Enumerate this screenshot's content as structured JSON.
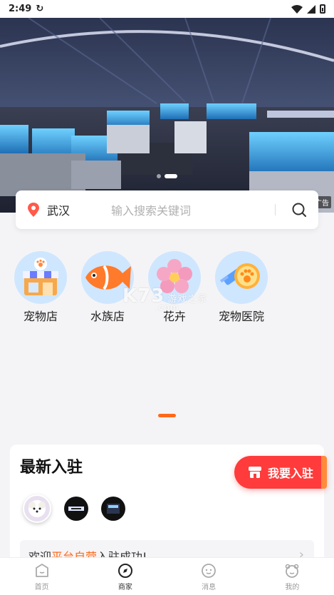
{
  "status_bar": {
    "time": "2:49"
  },
  "banner": {
    "tag": "广告",
    "slide_count": 2,
    "active_slide": 2
  },
  "search": {
    "city": "武汉",
    "placeholder": "输入搜索关键词"
  },
  "categories": [
    {
      "label": "宠物店",
      "icon": "pet-shop-icon"
    },
    {
      "label": "水族店",
      "icon": "fish-icon"
    },
    {
      "label": "花卉",
      "icon": "flower-icon"
    },
    {
      "label": "宠物医院",
      "icon": "pet-hospital-icon"
    }
  ],
  "watermark": {
    "text": "K73",
    "sub": "游戏之家",
    "domain": ".com"
  },
  "newest": {
    "title": "最新入驻",
    "join_button": "我要入驻",
    "welcome_prefix": "欢迎",
    "welcome_highlight": "平台自营",
    "welcome_suffix": "入驻成功!"
  },
  "tabbar": [
    {
      "label": "首页",
      "icon": "home-icon",
      "active": false
    },
    {
      "label": "商家",
      "icon": "compass-icon",
      "active": true
    },
    {
      "label": "消息",
      "icon": "message-icon",
      "active": false
    },
    {
      "label": "我的",
      "icon": "profile-icon",
      "active": false
    }
  ],
  "colors": {
    "accent": "#ff6a1a",
    "join_red": "#ff3b3b"
  }
}
